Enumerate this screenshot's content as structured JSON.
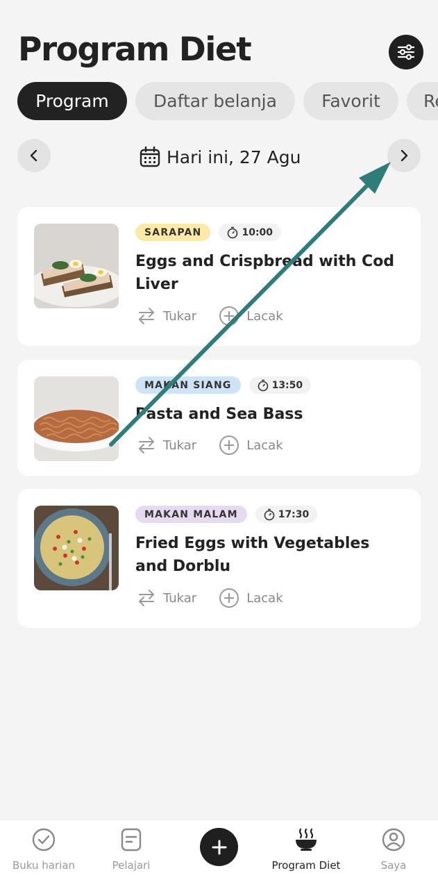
{
  "header": {
    "title": "Program Diet",
    "filter_icon": "sliders-icon"
  },
  "tabs": [
    {
      "label": "Program",
      "active": true
    },
    {
      "label": "Daftar belanja",
      "active": false
    },
    {
      "label": "Favorit",
      "active": false
    },
    {
      "label": "Re",
      "active": false
    }
  ],
  "date_nav": {
    "label": "Hari ini, 27 Agu",
    "prev_icon": "chevron-left-icon",
    "next_icon": "chevron-right-icon",
    "calendar_icon": "calendar-icon"
  },
  "meals": [
    {
      "category": "SARAPAN",
      "category_color": "#fbeaa8",
      "time": "10:00",
      "name": "Eggs and Crispbread with Cod Liver",
      "swap_label": "Tukar",
      "track_label": "Lacak"
    },
    {
      "category": "MAKAN SIANG",
      "category_color": "#cfe3f7",
      "time": "13:50",
      "name": "Pasta and Sea Bass",
      "swap_label": "Tukar",
      "track_label": "Lacak"
    },
    {
      "category": "MAKAN MALAM",
      "category_color": "#e6daf0",
      "time": "17:30",
      "name": "Fried Eggs with Vegetables and Dorblu",
      "swap_label": "Tukar",
      "track_label": "Lacak"
    }
  ],
  "bottom_nav": [
    {
      "label": "Buku harian",
      "icon": "check-circle-icon",
      "active": false
    },
    {
      "label": "Pelajari",
      "icon": "note-icon",
      "active": false
    },
    {
      "label": "",
      "icon": "plus-icon",
      "active": false
    },
    {
      "label": "Program Diet",
      "icon": "bowl-icon",
      "active": true
    },
    {
      "label": "Saya",
      "icon": "user-icon",
      "active": false
    }
  ],
  "colors": {
    "background": "#f4f4f4",
    "dark": "#1f1f1f",
    "arrow": "#2f7d78"
  }
}
